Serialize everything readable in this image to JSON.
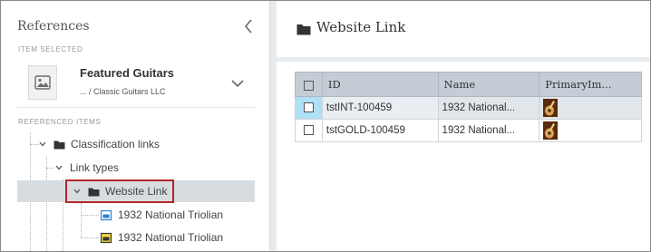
{
  "left_panel": {
    "title": "References",
    "item_selected_caption": "ITEM SELECTED",
    "selected_item": {
      "name": "Featured Guitars",
      "path": "... / Classic Guitars LLC"
    },
    "referenced_items_caption": "REFERENCED ITEMS",
    "tree": {
      "classification_links": "Classification links",
      "link_types": "Link types",
      "website_link": "Website Link",
      "child_1": "1932 National Triolian",
      "child_2": "1932 National Triolian"
    }
  },
  "right_panel": {
    "title": "Website Link",
    "grid": {
      "columns": [
        "",
        "ID",
        "Name",
        "PrimaryIm..."
      ],
      "rows": [
        {
          "id": "tstINT-100459",
          "name": "1932 National...",
          "selected": true
        },
        {
          "id": "tstGOLD-100459",
          "name": "1932 National...",
          "selected": false
        }
      ]
    }
  },
  "colors": {
    "selection_band": "#d7dce1",
    "highlight_box": "#b5252b",
    "grid_header": "#c4cdd5",
    "selected_check_cell": "#aee0f6"
  },
  "icons": [
    "chevron-left-icon",
    "image-placeholder-icon",
    "chevron-down-icon",
    "folder-icon",
    "product-blue-icon",
    "product-yellow-icon",
    "guitar-thumbnail"
  ]
}
